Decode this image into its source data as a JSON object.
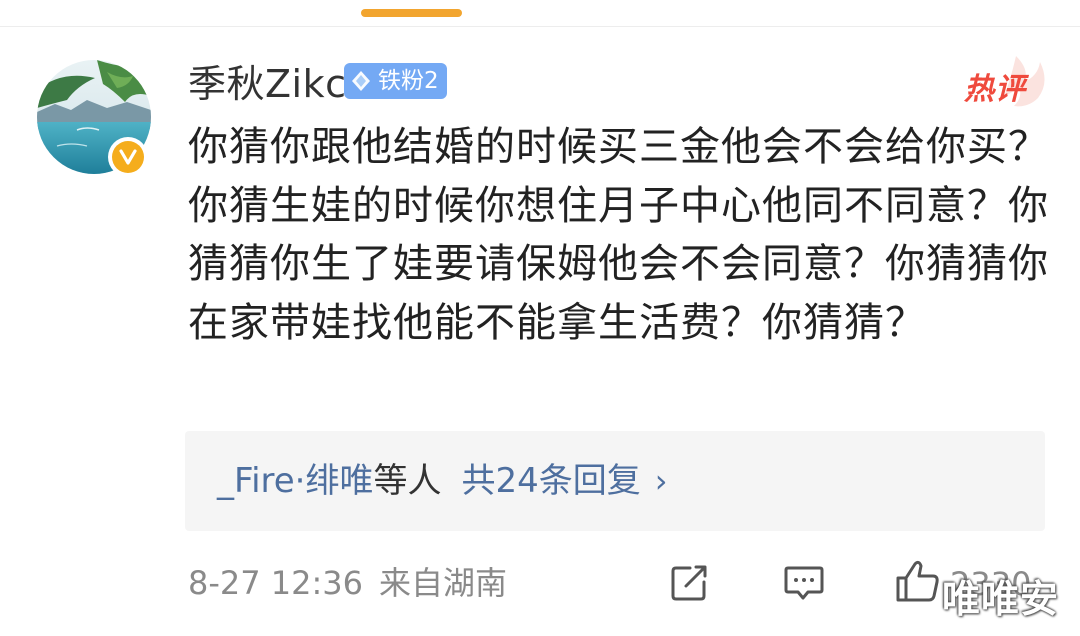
{
  "comment": {
    "username": "季秋Zikc",
    "fan_badge": "铁粉2",
    "hot_label": "热评",
    "text": "你猜你跟他结婚的时候买三金他会不会给你买？你猜生娃的时候你想住月子中心他同不同意？你猜猜你生了娃要请保姆他会不会同意？你猜猜你在家带娃找他能不能拿生活费？你猜猜？",
    "replies": {
      "names": "_Fire·绯唯",
      "suffix": "等人",
      "count_label": "共24条回复",
      "chevron": "›"
    },
    "meta": {
      "date": "8-27 12:36",
      "region": "来自湖南"
    },
    "like_count": "2330",
    "watermark": "唯唯安"
  },
  "icons": {
    "avatar": "landscape-avatar",
    "verified": "verified-badge-icon",
    "fan_badge": "diamond-icon",
    "share": "share-edit-icon",
    "comment": "comment-icon",
    "like": "thumbs-up-icon"
  },
  "colors": {
    "accent": "#f2a52f",
    "link": "#4e6f9f",
    "hot": "#ef4a3d",
    "badge_bg": "#74a9f4",
    "verified": "#f5ad1c"
  }
}
